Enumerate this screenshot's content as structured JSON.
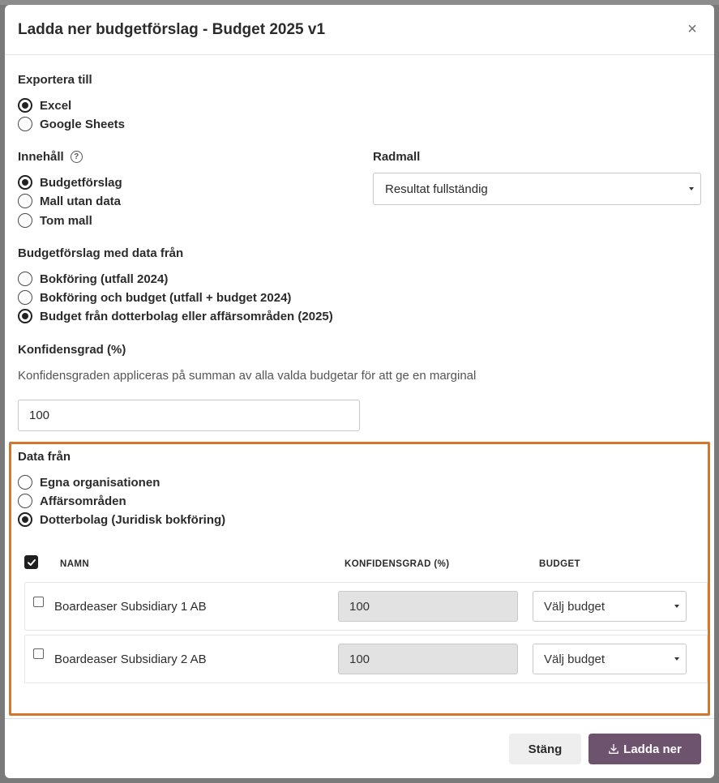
{
  "modal": {
    "title": "Ladda ner budgetförslag - Budget 2025 v1",
    "close_symbol": "×"
  },
  "export": {
    "label": "Exportera till",
    "options": [
      {
        "label": "Excel",
        "checked": true
      },
      {
        "label": "Google Sheets",
        "checked": false
      }
    ]
  },
  "content": {
    "label": "Innehåll",
    "help_symbol": "?",
    "options": [
      {
        "label": "Budgetförslag",
        "checked": true
      },
      {
        "label": "Mall utan data",
        "checked": false
      },
      {
        "label": "Tom mall",
        "checked": false
      }
    ]
  },
  "row_template": {
    "label": "Radmall",
    "value": "Resultat fullständig"
  },
  "data_source": {
    "label": "Budgetförslag med data från",
    "options": [
      {
        "label": "Bokföring (utfall 2024)",
        "checked": false
      },
      {
        "label": "Bokföring och budget (utfall + budget 2024)",
        "checked": false
      },
      {
        "label": "Budget från dotterbolag eller affärsområden (2025)",
        "checked": true
      }
    ]
  },
  "confidence": {
    "label": "Konfidensgrad (%)",
    "helper": "Konfidensgraden appliceras på summan av alla valda budgetar för att ge en marginal",
    "value": "100"
  },
  "data_from": {
    "label": "Data från",
    "highlight_color": "#d4762e",
    "options": [
      {
        "label": "Egna organisationen",
        "checked": false
      },
      {
        "label": "Affärsområden",
        "checked": false
      },
      {
        "label": "Dotterbolag (Juridisk bokföring)",
        "checked": true
      }
    ]
  },
  "table": {
    "headers": {
      "name": "NAMN",
      "confidence": "KONFIDENSGRAD (%)",
      "budget": "BUDGET"
    },
    "select_all_checked": true,
    "rows": [
      {
        "name": "Boardeaser Subsidiary 1 AB",
        "confidence": "100",
        "budget": "Välj budget",
        "checked": false
      },
      {
        "name": "Boardeaser Subsidiary 2 AB",
        "confidence": "100",
        "budget": "Välj budget",
        "checked": false
      }
    ]
  },
  "footer": {
    "close_label": "Stäng",
    "download_label": "Ladda ner",
    "download_color": "#6e536e",
    "download_icon": "download-icon"
  }
}
